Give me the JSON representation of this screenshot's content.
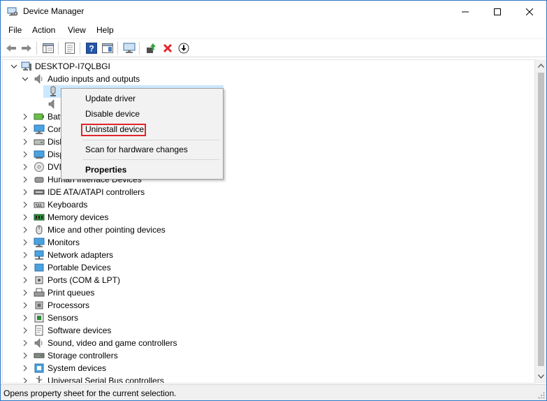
{
  "window": {
    "title": "Device Manager",
    "app_icon": "device-manager-icon"
  },
  "menu": [
    "File",
    "Action",
    "View",
    "Help"
  ],
  "toolbar": {
    "buttons": [
      "back-icon",
      "forward-icon",
      "show-hide-tree-icon",
      "properties-icon",
      "help-icon",
      "action-pane-icon",
      "display-icon",
      "update-driver-icon",
      "uninstall-icon",
      "enable-device-icon"
    ]
  },
  "tree": {
    "root": "DESKTOP-I7QLBGI",
    "expanded_category": "Audio inputs and outputs",
    "categories": [
      {
        "label": "Batt",
        "icon": "battery-icon"
      },
      {
        "label": "Con",
        "icon": "computer-icon"
      },
      {
        "label": "Disk",
        "icon": "disk-drive-icon"
      },
      {
        "label": "Disp",
        "icon": "display-adapter-icon"
      },
      {
        "label": "DVD",
        "icon": "dvd-icon"
      },
      {
        "label": "Human Interface Devices",
        "icon": "hid-icon"
      },
      {
        "label": "IDE ATA/ATAPI controllers",
        "icon": "ide-icon"
      },
      {
        "label": "Keyboards",
        "icon": "keyboard-icon"
      },
      {
        "label": "Memory devices",
        "icon": "memory-icon"
      },
      {
        "label": "Mice and other pointing devices",
        "icon": "mouse-icon"
      },
      {
        "label": "Monitors",
        "icon": "monitor-icon"
      },
      {
        "label": "Network adapters",
        "icon": "network-icon"
      },
      {
        "label": "Portable Devices",
        "icon": "portable-device-icon"
      },
      {
        "label": "Ports (COM & LPT)",
        "icon": "port-icon"
      },
      {
        "label": "Print queues",
        "icon": "printer-icon"
      },
      {
        "label": "Processors",
        "icon": "processor-icon"
      },
      {
        "label": "Sensors",
        "icon": "sensor-icon"
      },
      {
        "label": "Software devices",
        "icon": "software-device-icon"
      },
      {
        "label": "Sound, video and game controllers",
        "icon": "sound-icon"
      },
      {
        "label": "Storage controllers",
        "icon": "storage-icon"
      },
      {
        "label": "System devices",
        "icon": "system-device-icon"
      },
      {
        "label": "Universal Serial Bus controllers",
        "icon": "usb-icon"
      }
    ]
  },
  "context_menu": {
    "update": "Update driver",
    "disable": "Disable device",
    "uninstall": "Uninstall device",
    "scan": "Scan for hardware changes",
    "properties": "Properties"
  },
  "status": {
    "text": "Opens property sheet for the current selection."
  },
  "colors": {
    "highlight_box": "#e0262c",
    "selection": "#cce8ff",
    "window_border": "#2b78c7"
  }
}
